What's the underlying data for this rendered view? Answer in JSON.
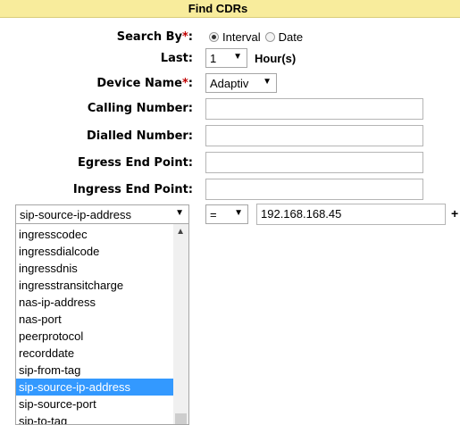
{
  "header": {
    "title": "Find CDRs"
  },
  "form": {
    "search_by_label": "Search By",
    "required_mark": "*",
    "colon": ":",
    "search_options": [
      "Interval",
      "Date"
    ],
    "last_label": "Last:",
    "last_value": "1",
    "last_unit": "Hour(s)",
    "device_label": "Device Name",
    "device_value": "Adaptiv",
    "calling_label": "Calling Number:",
    "dialled_label": "Dialled Number:",
    "egress_label": "Egress End Point:",
    "ingress_label": "Ingress End Point:"
  },
  "filter": {
    "field_value": "sip-source-ip-address",
    "operator_value": "=",
    "value": "192.168.168.45",
    "add_label": "+"
  },
  "dropdown": {
    "items": [
      "ingresscodec",
      "ingressdialcode",
      "ingressdnis",
      "ingresstransitcharge",
      "nas-ip-address",
      "nas-port",
      "peerprotocol",
      "recorddate",
      "sip-from-tag",
      "sip-source-ip-address",
      "sip-source-port",
      "sip-to-tag"
    ],
    "selected": "sip-source-ip-address"
  },
  "icons": {
    "arrow": "▼",
    "scroll_up": "▲"
  }
}
